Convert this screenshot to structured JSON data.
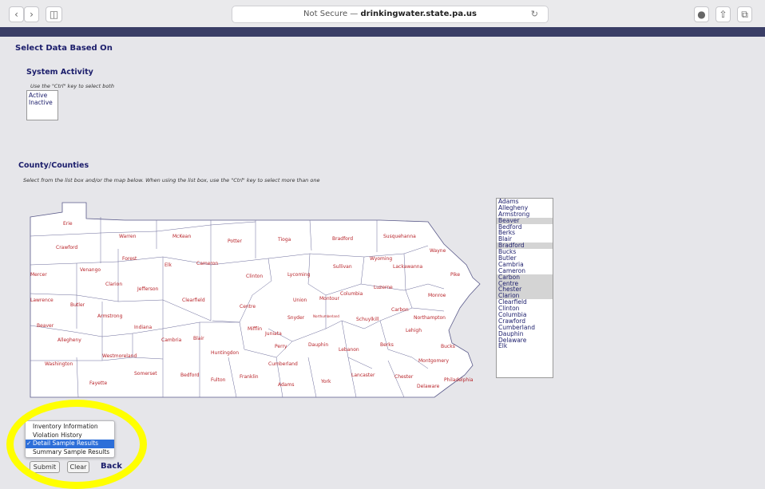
{
  "browser": {
    "address_prefix": "Not Secure — ",
    "address_host": "drinkingwater.state.pa.us"
  },
  "page": {
    "heading": "Select Data Based On",
    "system_activity": {
      "title": "System Activity",
      "hint": "Use the \"Ctrl\" key to select both",
      "options": [
        "Active",
        "Inactive"
      ]
    },
    "county": {
      "title": "County/Counties",
      "hint": "Select from the list box and/or the map below. When using the list box, use the \"Ctrl\" key to select more than one",
      "list": [
        {
          "name": "Adams",
          "selected": false
        },
        {
          "name": "Allegheny",
          "selected": false
        },
        {
          "name": "Armstrong",
          "selected": false
        },
        {
          "name": "Beaver",
          "selected": true
        },
        {
          "name": "Bedford",
          "selected": false
        },
        {
          "name": "Berks",
          "selected": false
        },
        {
          "name": "Blair",
          "selected": false
        },
        {
          "name": "Bradford",
          "selected": true
        },
        {
          "name": "Bucks",
          "selected": false
        },
        {
          "name": "Butler",
          "selected": false
        },
        {
          "name": "Cambria",
          "selected": false
        },
        {
          "name": "Cameron",
          "selected": false
        },
        {
          "name": "Carbon",
          "selected": true
        },
        {
          "name": "Centre",
          "selected": true
        },
        {
          "name": "Chester",
          "selected": true
        },
        {
          "name": "Clarion",
          "selected": true
        },
        {
          "name": "Clearfield",
          "selected": false
        },
        {
          "name": "Clinton",
          "selected": false
        },
        {
          "name": "Columbia",
          "selected": false
        },
        {
          "name": "Crawford",
          "selected": false
        },
        {
          "name": "Cumberland",
          "selected": false
        },
        {
          "name": "Dauphin",
          "selected": false
        },
        {
          "name": "Delaware",
          "selected": false
        },
        {
          "name": "Elk",
          "selected": false
        }
      ]
    },
    "map_labels": [
      "Erie",
      "Warren",
      "McKean",
      "Potter",
      "Tioga",
      "Bradford",
      "Susquehanna",
      "Crawford",
      "Forest",
      "Elk",
      "Cameron",
      "Wayne",
      "Wyoming",
      "Lackawanna",
      "Mercer",
      "Venango",
      "Clinton",
      "Lycoming",
      "Sullivan",
      "Pike",
      "Clarion",
      "Jefferson",
      "Luzerne",
      "Lawrence",
      "Butler",
      "Clearfield",
      "Centre",
      "Union",
      "Montour",
      "Columbia",
      "Monroe",
      "Armstrong",
      "Carbon",
      "Beaver",
      "Indiana",
      "Snyder",
      "Northumberland",
      "Schuylkill",
      "Northampton",
      "Allegheny",
      "Cambria",
      "Blair",
      "Mifflin",
      "Juniata",
      "Lehigh",
      "Huntingdon",
      "Perry",
      "Dauphin",
      "Lebanon",
      "Berks",
      "Bucks",
      "Westmoreland",
      "Washington",
      "Somerset",
      "Bedford",
      "Fulton",
      "Franklin",
      "Cumberland",
      "Montgomery",
      "Fayette",
      "Adams",
      "York",
      "Lancaster",
      "Chester",
      "Delaware",
      "Philadelphia"
    ],
    "report_options": [
      {
        "label": "Inventory Information",
        "selected": false
      },
      {
        "label": "Violation History",
        "selected": false
      },
      {
        "label": "Detail Sample Results",
        "selected": true
      },
      {
        "label": "Summary Sample Results",
        "selected": false
      }
    ],
    "buttons": {
      "submit": "Submit",
      "clear": "Clear",
      "back": "Back"
    }
  }
}
